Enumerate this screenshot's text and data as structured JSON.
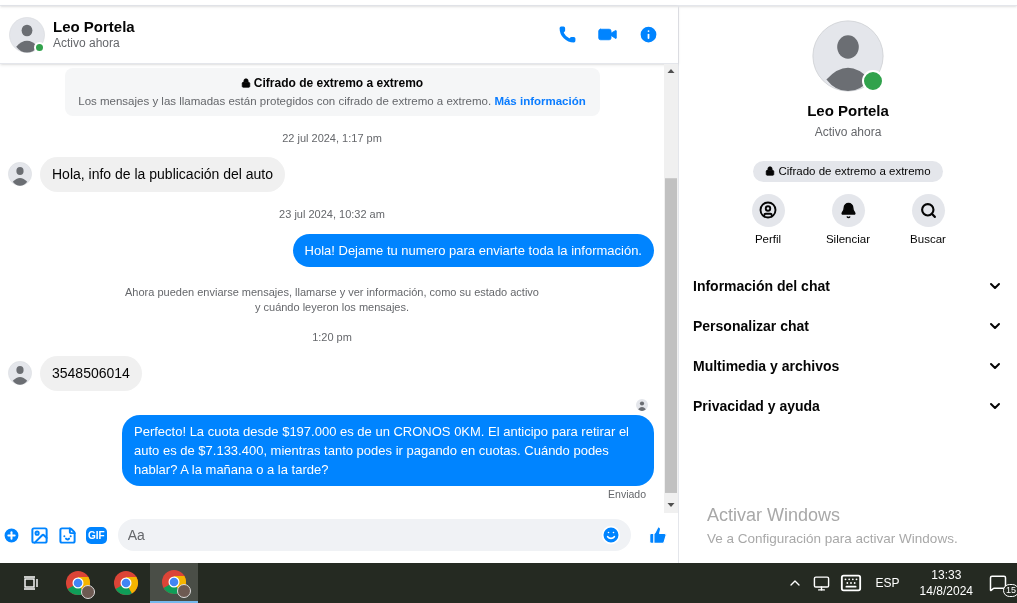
{
  "header": {
    "name": "Leo Portela",
    "status": "Activo ahora",
    "online": true
  },
  "encryption_notice": {
    "title": "Cifrado de extremo a extremo",
    "text": "Los mensajes y las llamadas están protegidos con cifrado de extremo a extremo.",
    "link": "Más información"
  },
  "messages": [
    {
      "kind": "timestamp",
      "text": "22 jul 2024, 1:17 pm"
    },
    {
      "kind": "incoming",
      "text": "Hola, info de la publicación del auto"
    },
    {
      "kind": "timestamp",
      "text": "23 jul 2024, 10:32 am"
    },
    {
      "kind": "outgoing",
      "text": "Hola! Dejame tu numero  para enviarte toda la información."
    },
    {
      "kind": "system",
      "text": "Ahora pueden enviarse mensajes, llamarse y ver información, como su estado activo y cuándo leyeron los mensajes."
    },
    {
      "kind": "timestamp",
      "text": "1:20 pm"
    },
    {
      "kind": "incoming",
      "text": "3548506014"
    },
    {
      "kind": "seen"
    },
    {
      "kind": "outgoing",
      "text": "Perfecto! La cuota desde $197.000 es de un CRONOS 0KM. El anticipo para retirar el auto es de $7.133.400, mientras tanto podes ir pagando en cuotas. Cuándo podes hablar? A la mañana o a la tarde?",
      "status": "Enviado"
    }
  ],
  "composer": {
    "gif_label": "GIF",
    "placeholder": "Aa"
  },
  "info_panel": {
    "name": "Leo Portela",
    "status": "Activo ahora",
    "online": true,
    "encryption_badge": "Cifrado de extremo a extremo",
    "actions": [
      {
        "kind": "profile",
        "label": "Perfil"
      },
      {
        "kind": "mute",
        "label": "Silenciar"
      },
      {
        "kind": "search",
        "label": "Buscar"
      }
    ],
    "sections": [
      {
        "label": "Información del chat",
        "expanded": false
      },
      {
        "label": "Personalizar chat",
        "expanded": false
      },
      {
        "label": "Multimedia y archivos",
        "expanded": false
      },
      {
        "label": "Privacidad y ayuda",
        "expanded": false
      }
    ]
  },
  "windows_activation": {
    "title": "Activar Windows",
    "text": "Ve a Configuración para activar Windows."
  },
  "taskbar": {
    "apps": [
      {
        "kind": "browser",
        "badge": true,
        "selected": false
      },
      {
        "kind": "browser",
        "badge": false,
        "selected": false
      },
      {
        "kind": "browser",
        "badge": true,
        "selected": true
      }
    ],
    "language": "ESP",
    "time": "13:33",
    "date": "14/8/2024",
    "notification_count": "15"
  }
}
